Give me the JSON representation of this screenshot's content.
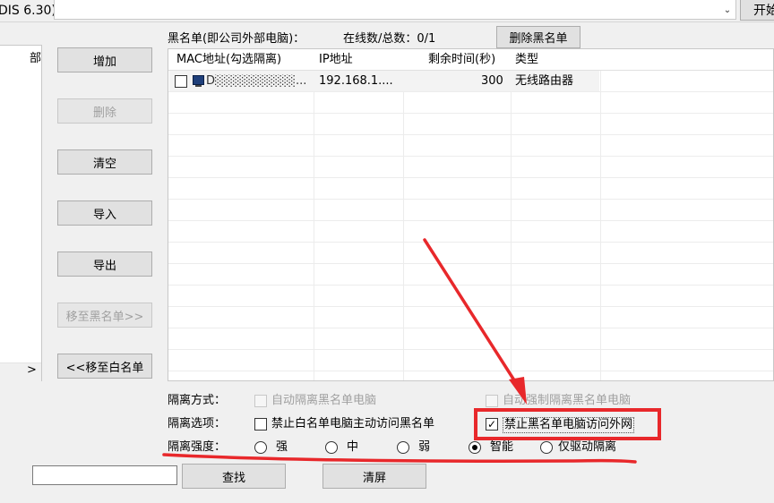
{
  "topbar": {
    "title_fragment": "DIS 6.30)",
    "start_label": "开始"
  },
  "left_panel": {
    "header_fragment": "部",
    "scroll_arrow": ">"
  },
  "buttons": {
    "add": "增加",
    "delete": "删除",
    "clear": "清空",
    "import": "导入",
    "export": "导出",
    "move_to_blacklist": "移至黑名单>>",
    "move_to_whitelist": "<<移至白名单",
    "delete_blacklist": "删除黑名单",
    "search": "查找",
    "clear_screen": "清屏"
  },
  "blacklist": {
    "title": "黑名单(即公司外部电脑)：",
    "count_label": "在线数/总数：0/1",
    "columns": [
      "MAC地址(勾选隔离)",
      "IP地址",
      "剩余时间(秒)",
      "类型"
    ],
    "rows": [
      {
        "mac": "D░░░░░░░░░...",
        "ip": "192.168.1....",
        "remaining": "300",
        "type": "无线路由器"
      }
    ]
  },
  "isolation": {
    "method_label": "隔离方式：",
    "auto_isolate": "自动隔离黑名单电脑",
    "auto_force_isolate": "自动强制隔离黑名单电脑",
    "options_label": "隔离选项：",
    "forbid_white_access": "禁止白名单电脑主动访问黑名单",
    "forbid_black_internet": "禁止黑名单电脑访问外网",
    "strength_label": "隔离强度：",
    "strength_options": [
      "强",
      "中",
      "弱",
      "智能",
      "仅驱动隔离"
    ],
    "strength_selected": "智能"
  },
  "search": {
    "value": ""
  },
  "annotation": {
    "color": "#e8282b"
  }
}
